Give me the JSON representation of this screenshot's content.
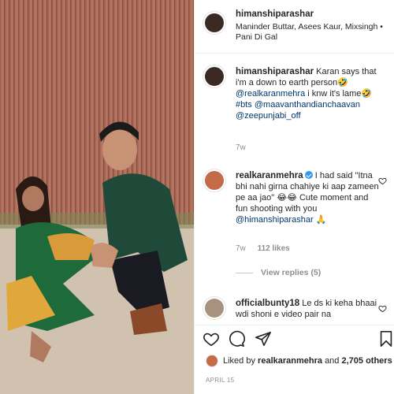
{
  "post": {
    "author": "himanshiparashar",
    "music": "Maninder Buttar, Asees Kaur, Mixsingh • Pani Di Gal",
    "likes_prefix": "Liked by",
    "liked_by_user": "realkaranmehra",
    "likes_and": "and",
    "likes_others": "2,705 others",
    "date": "April 15"
  },
  "caption": {
    "username": "himanshiparashar",
    "text_line1": "Karan says that i'm a down to earth person🤣",
    "mention1": "@realkaranmehra",
    "text_mid": "i knw it's lame🤣",
    "hashtag": "#bts",
    "mention2": "@maavanthandianchaavan",
    "mention3": "@zeepunjabi_off",
    "time": "7w"
  },
  "comments": [
    {
      "username": "realkaranmehra",
      "verified": true,
      "text": "I had said \"Itna bhi nahi girna chahiye ki aap zameen pe aa jao\" 😂😂 Cute moment and fun shooting with you",
      "mention": "@himanshiparashar",
      "trail": "🙏",
      "time": "7w",
      "likes": "112 likes",
      "view_replies": "View replies (5)"
    },
    {
      "username": "officialbunty18",
      "text": "Le ds ki keha bhaai wdi shoni e video pair na"
    }
  ],
  "colors": {
    "link": "#00376b",
    "muted": "#8e8e8e",
    "verified": "#3897f0"
  },
  "icons": {
    "like": "heart-icon",
    "comment": "comment-bubble-icon",
    "share": "paper-plane-icon",
    "save": "bookmark-icon"
  }
}
